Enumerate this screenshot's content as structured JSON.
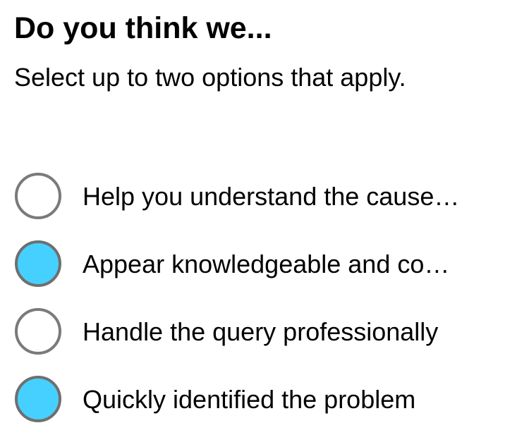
{
  "question": {
    "title": "Do you think we...",
    "instructions": "Select up to two options that apply."
  },
  "options": [
    {
      "label": "Help you understand the cause…",
      "selected": false
    },
    {
      "label": "Appear knowledgeable and co…",
      "selected": true
    },
    {
      "label": "Handle the query professionally",
      "selected": false
    },
    {
      "label": "Quickly identified the problem",
      "selected": true
    }
  ],
  "colors": {
    "selected_fill": "#46d0ff",
    "radio_border": "#7a7a7a",
    "background": "#ffffff",
    "text": "#000000"
  }
}
